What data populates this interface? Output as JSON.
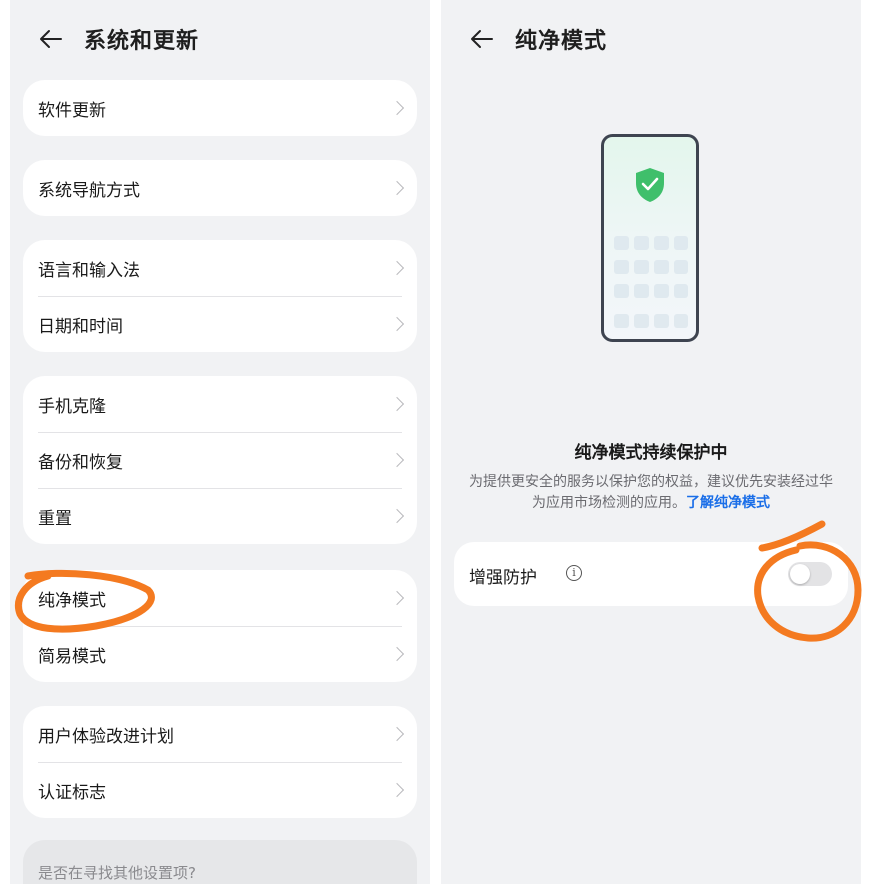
{
  "left": {
    "title": "系统和更新",
    "groups": [
      {
        "items": [
          {
            "label": "软件更新"
          }
        ]
      },
      {
        "items": [
          {
            "label": "系统导航方式"
          }
        ]
      },
      {
        "items": [
          {
            "label": "语言和输入法"
          },
          {
            "label": "日期和时间"
          }
        ]
      },
      {
        "items": [
          {
            "label": "手机克隆"
          },
          {
            "label": "备份和恢复"
          },
          {
            "label": "重置"
          }
        ]
      },
      {
        "items": [
          {
            "label": "纯净模式"
          },
          {
            "label": "简易模式"
          }
        ]
      },
      {
        "items": [
          {
            "label": "用户体验改进计划"
          },
          {
            "label": "认证标志"
          }
        ]
      }
    ],
    "search_hint": "是否在寻找其他设置项?"
  },
  "right": {
    "title": "纯净模式",
    "status_title": "纯净模式持续保护中",
    "description": "为提供更安全的服务以保护您的权益，建议优先安装经过华为应用市场检测的应用。",
    "learn_more": "了解纯净模式",
    "toggle_label": "增强防护",
    "toggle_on": false
  },
  "icons": {
    "back": "back-arrow-icon",
    "chevron": "chevron-right-icon",
    "info": "info-icon",
    "shield": "shield-check-icon"
  },
  "colors": {
    "background": "#f1f2f4",
    "card": "#ffffff",
    "link": "#1a6ee8",
    "annotation": "#f47a20",
    "shield": "#3fbf6b"
  }
}
